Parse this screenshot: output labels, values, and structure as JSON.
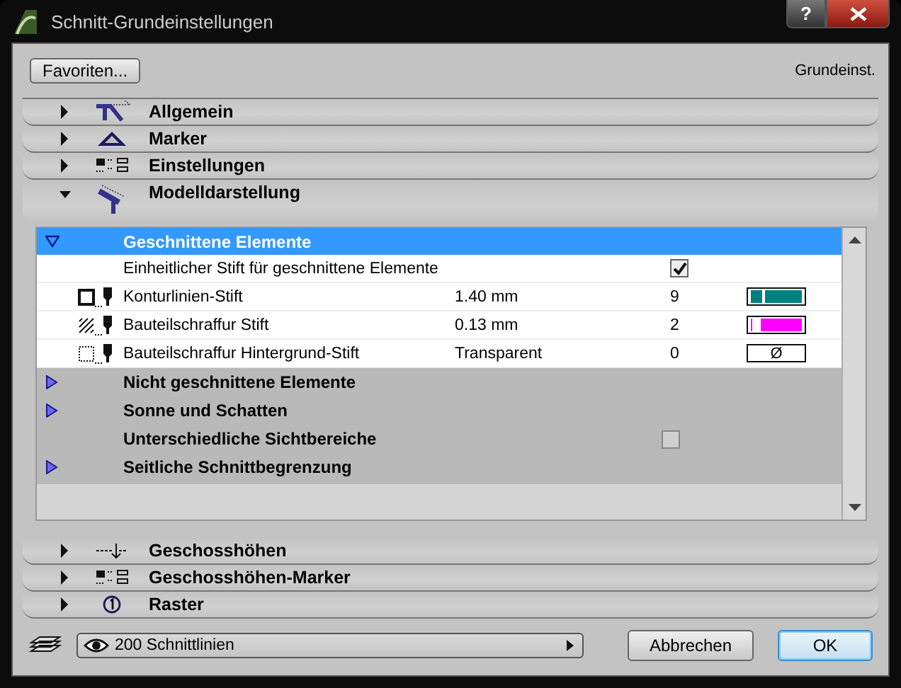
{
  "window": {
    "title": "Schnitt-Grundeinstellungen",
    "help_button": "?"
  },
  "toolbar": {
    "favorites_button": "Favoriten...",
    "preset_label": "Grundeinst."
  },
  "panels": [
    {
      "label": "Allgemein",
      "expanded": false
    },
    {
      "label": "Marker",
      "expanded": false
    },
    {
      "label": "Einstellungen",
      "expanded": false
    },
    {
      "label": "Modelldarstellung",
      "expanded": true,
      "groups": [
        {
          "label": "Geschnittene Elemente",
          "kind": "tree",
          "expanded": true,
          "selected": true,
          "rows": [
            {
              "kind": "checkbox",
              "label": "Einheitlicher Stift für geschnittene Elemente",
              "checked": true
            },
            {
              "kind": "contour",
              "label": "Konturlinien-Stift",
              "value": "1.40 mm",
              "pen": "9",
              "color": "#008080"
            },
            {
              "kind": "fill",
              "label": "Bauteilschraffur Stift",
              "value": "0.13 mm",
              "pen": "2",
              "color": "#ff00ff"
            },
            {
              "kind": "background",
              "label": "Bauteilschraffur Hintergrund-Stift",
              "value": "Transparent",
              "pen": "0",
              "swatch_text": "Ø"
            }
          ]
        },
        {
          "label": "Nicht geschnittene Elemente",
          "kind": "tree",
          "expanded": false,
          "selected": false
        },
        {
          "label": "Sonne und Schatten",
          "kind": "tree",
          "expanded": false,
          "selected": false
        },
        {
          "label": "Unterschiedliche Sichtbereiche",
          "kind": "checkbox",
          "checked": false,
          "disabled": true
        },
        {
          "label": "Seitliche Schnittbegrenzung",
          "kind": "tree",
          "expanded": false,
          "selected": false
        }
      ]
    },
    {
      "label": "Geschosshöhen",
      "expanded": false
    },
    {
      "label": "Geschosshöhen-Marker",
      "expanded": false
    },
    {
      "label": "Raster",
      "expanded": false
    }
  ],
  "footer": {
    "layer_combo": "200 Schnittlinien",
    "buttons": [
      {
        "label": "Abbrechen",
        "default": false
      },
      {
        "label": "OK",
        "default": true
      }
    ]
  }
}
